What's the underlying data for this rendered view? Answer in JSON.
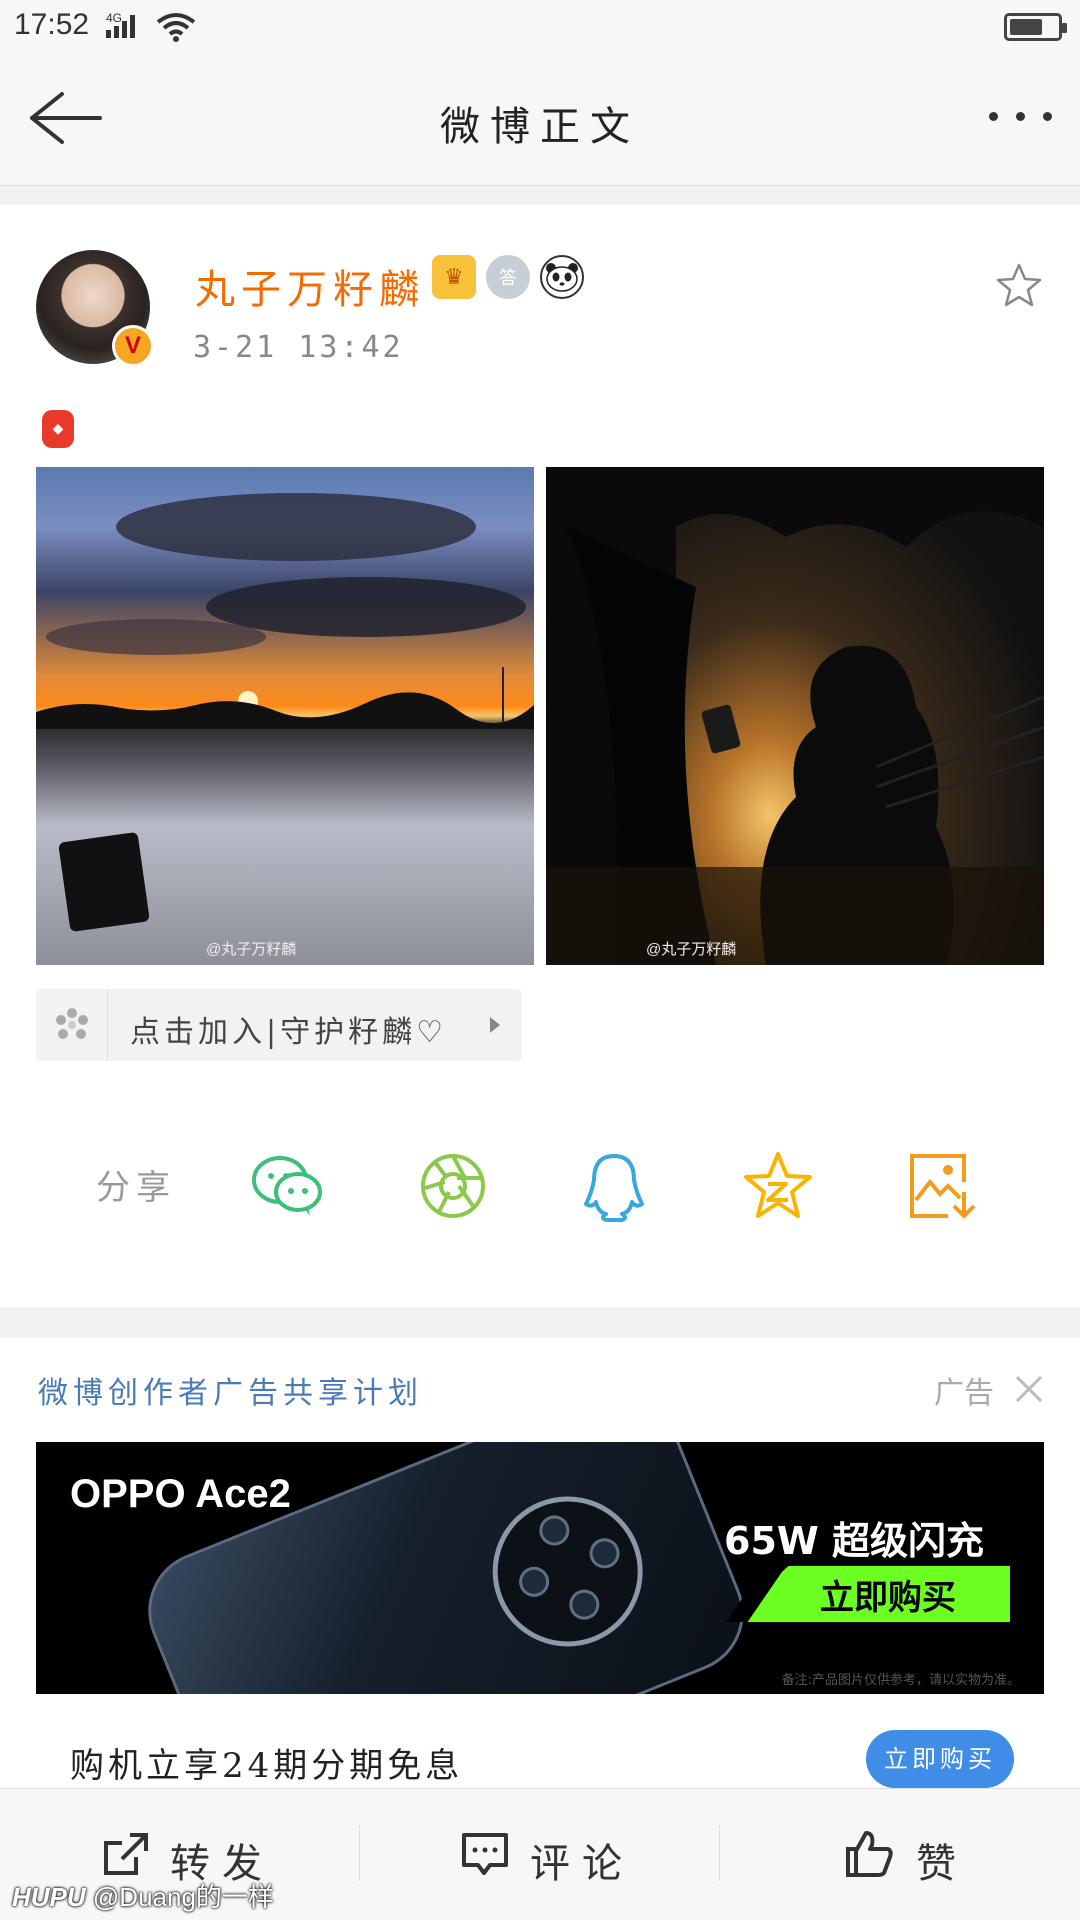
{
  "status_bar": {
    "time": "17:52",
    "network": "4G",
    "battery_level": 0.7
  },
  "nav": {
    "title": "微博正文"
  },
  "post": {
    "author": "丸子万籽麟",
    "badges": [
      "crown-badge-icon",
      "answer-badge-icon",
      "panda-badge-icon"
    ],
    "time": "3-21 13:42",
    "images": [
      {
        "watermark": "@丸子万籽麟"
      },
      {
        "watermark": "@丸子万籽麟"
      }
    ],
    "group_link": "点击加入|守护籽麟♡"
  },
  "share": {
    "label": "分享",
    "targets": [
      "wechat-icon",
      "moments-icon",
      "qq-icon",
      "qzone-icon",
      "save-image-icon"
    ]
  },
  "ad": {
    "program": "微博创作者广告共享计划",
    "tag": "广告",
    "model": "OPPO Ace2",
    "charge": "65W 超级闪充",
    "buy_strip": "立即购买",
    "disclaimer": "备注:产品图片仅供参考，请以实物为准。",
    "promo": "购机立享24期分期免息",
    "buy_button": "立即购买"
  },
  "bottom_bar": {
    "repost": "转发",
    "comment": "评论",
    "like": "赞"
  },
  "watermark": {
    "brand": "HUPU",
    "user": "@Duang的一样"
  },
  "colors": {
    "author": "#f56b00",
    "program": "#4a7bb5",
    "wechat": "#3cbf7a",
    "moments": "#8cc84b",
    "qq": "#3aa6e0",
    "qzone": "#f7b500",
    "save": "#f29b1d",
    "buy_button": "#3f8de6",
    "buy_strip": "#6bff22"
  }
}
